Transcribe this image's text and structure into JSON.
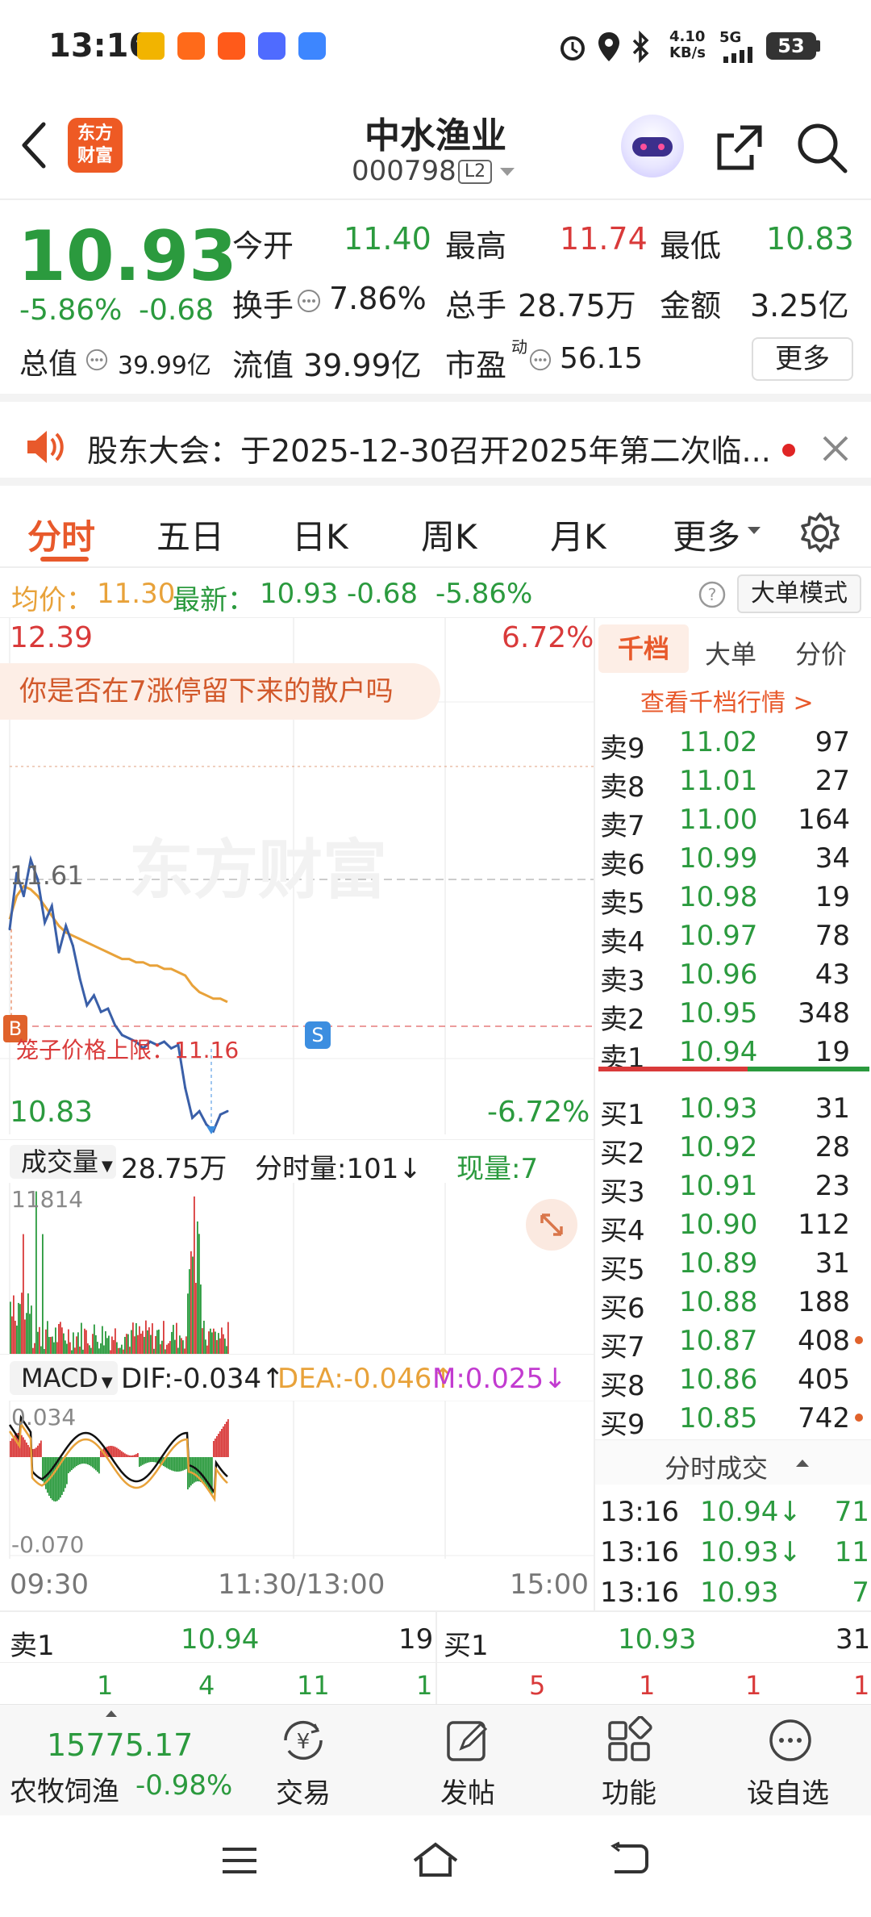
{
  "status_bar": {
    "time": "13:16",
    "net_speed": "4.10\nKB/s",
    "net_speed_top": "4.10",
    "net_speed_bottom": "KB/s",
    "signal": "5G",
    "battery": "53"
  },
  "header": {
    "logo_line1": "东方",
    "logo_line2": "财富",
    "title": "中水渔业",
    "code": "000798",
    "level_badge": "L2"
  },
  "quote": {
    "price": "10.93",
    "change_pct": "-5.86%",
    "change": "-0.68",
    "open_label": "今开",
    "open": "11.40",
    "high_label": "最高",
    "high": "11.74",
    "low_label": "最低",
    "low": "10.83",
    "turnover_label": "换手",
    "turnover": "7.86%",
    "volume_label": "总手",
    "volume": "28.75万",
    "amount_label": "金额",
    "amount": "3.25亿",
    "mktcap_label": "总值",
    "mktcap": "39.99亿",
    "float_label": "流值",
    "float": "39.99亿",
    "pe_label": "市盈",
    "pe_sup": "动",
    "pe": "56.15",
    "more_button": "更多"
  },
  "notice": {
    "text": "股东大会：于2025-12-30召开2025年第二次临..."
  },
  "tabs": [
    {
      "label": "分时",
      "active": true
    },
    {
      "label": "五日"
    },
    {
      "label": "日K"
    },
    {
      "label": "周K"
    },
    {
      "label": "月K"
    },
    {
      "label": "更多"
    }
  ],
  "avg_line": {
    "avg_label": "均价：",
    "avg": "11.30",
    "latest_label": "最新：",
    "latest": "10.93",
    "change": "-0.68",
    "change_pct": "-5.86%",
    "mode_button": "大单模式"
  },
  "chart": {
    "price_top": "12.39",
    "pct_top": "6.72%",
    "price_bottom": "10.83",
    "pct_bottom": "-6.72%",
    "mid_price": "11.61",
    "promo": "你是否在7涨停留下来的散户吗",
    "limit_label": "笼子价格上限：11.16",
    "marker_b": "B",
    "marker_s": "S",
    "watermark": "东方财富",
    "volume_label": "成交量",
    "volume_total": "28.75万",
    "tick_vol_label": "分时量:101↓",
    "now_vol_label": "现量:7",
    "vol_max": "11814",
    "macd_label": "MACD",
    "dif": "DIF:-0.034↑",
    "dea": "DEA:-0.046↑",
    "m": "M:0.025↓",
    "macd_top": "0.034",
    "macd_bottom": "-0.070",
    "time_start": "09:30",
    "time_mid": "11:30/13:00",
    "time_end": "15:00"
  },
  "chart_data": {
    "type": "line",
    "title": "",
    "xlabel": "",
    "ylabel": "",
    "ylim": [
      10.83,
      12.39
    ],
    "x": [
      "09:30",
      "11:30/13:00",
      "15:00"
    ],
    "series": [
      {
        "name": "",
        "color": "#3a5fa8",
        "values": [
          11.45,
          11.62,
          11.55,
          11.66,
          11.6,
          11.47,
          11.52,
          11.38,
          11.46,
          11.4,
          11.3,
          11.22,
          11.25,
          11.2,
          11.21,
          11.16,
          11.13,
          11.12,
          11.11,
          11.09,
          11.11,
          11.1,
          11.11,
          11.09,
          11.1,
          10.97,
          10.88,
          10.9,
          10.86,
          10.84,
          10.89,
          10.9
        ]
      },
      {
        "name": "",
        "color": "#e8a23a",
        "values": [
          11.48,
          11.55,
          11.58,
          11.57,
          11.55,
          11.52,
          11.49,
          11.46,
          11.44,
          11.43,
          11.42,
          11.41,
          11.4,
          11.39,
          11.38,
          11.37,
          11.36,
          11.36,
          11.35,
          11.35,
          11.34,
          11.34,
          11.33,
          11.33,
          11.32,
          11.31,
          11.28,
          11.26,
          11.25,
          11.24,
          11.24,
          11.23
        ]
      }
    ]
  },
  "orderbook": {
    "tabs": [
      "千档",
      "大单",
      "分价"
    ],
    "link": "查看千档行情 >",
    "asks": [
      {
        "label": "卖9",
        "price": "11.02",
        "vol": "97"
      },
      {
        "label": "卖8",
        "price": "11.01",
        "vol": "27"
      },
      {
        "label": "卖7",
        "price": "11.00",
        "vol": "164"
      },
      {
        "label": "卖6",
        "price": "10.99",
        "vol": "34"
      },
      {
        "label": "卖5",
        "price": "10.98",
        "vol": "19"
      },
      {
        "label": "卖4",
        "price": "10.97",
        "vol": "78"
      },
      {
        "label": "卖3",
        "price": "10.96",
        "vol": "43"
      },
      {
        "label": "卖2",
        "price": "10.95",
        "vol": "348"
      },
      {
        "label": "卖1",
        "price": "10.94",
        "vol": "19"
      }
    ],
    "bids": [
      {
        "label": "买1",
        "price": "10.93",
        "vol": "31"
      },
      {
        "label": "买2",
        "price": "10.92",
        "vol": "28"
      },
      {
        "label": "买3",
        "price": "10.91",
        "vol": "23"
      },
      {
        "label": "买4",
        "price": "10.90",
        "vol": "112"
      },
      {
        "label": "买5",
        "price": "10.89",
        "vol": "31"
      },
      {
        "label": "买6",
        "price": "10.88",
        "vol": "188"
      },
      {
        "label": "买7",
        "price": "10.87",
        "vol": "408"
      },
      {
        "label": "买8",
        "price": "10.86",
        "vol": "405"
      },
      {
        "label": "买9",
        "price": "10.85",
        "vol": "742"
      }
    ],
    "trades_title": "分时成交",
    "trades": [
      {
        "time": "13:16",
        "price": "10.94↓",
        "vol": "71"
      },
      {
        "time": "13:16",
        "price": "10.93↓",
        "vol": "11"
      },
      {
        "time": "13:16",
        "price": "10.93",
        "vol": "7"
      }
    ]
  },
  "bottom_quote": {
    "ask_label": "卖1",
    "ask_price": "10.94",
    "ask_vol": "19",
    "bid_label": "买1",
    "bid_price": "10.93",
    "bid_vol": "31",
    "ask_queue": [
      "1",
      "4",
      "11",
      "1"
    ],
    "bid_queue": [
      "5",
      "1",
      "1",
      "1"
    ]
  },
  "bottom_bar": {
    "index_value": "15775.17",
    "index_name": "农牧饲渔",
    "index_change": "-0.98%",
    "items": [
      {
        "label": "交易",
        "icon": "yen-refresh-icon"
      },
      {
        "label": "发帖",
        "icon": "edit-icon"
      },
      {
        "label": "功能",
        "icon": "grid-icon"
      },
      {
        "label": "设自选",
        "icon": "more-icon"
      }
    ]
  },
  "colors": {
    "red": "#d93a3a",
    "green": "#2b9a3e",
    "blue_line": "#3a5fa8",
    "orange_line": "#e8a23a",
    "accent": "#e8592b"
  }
}
